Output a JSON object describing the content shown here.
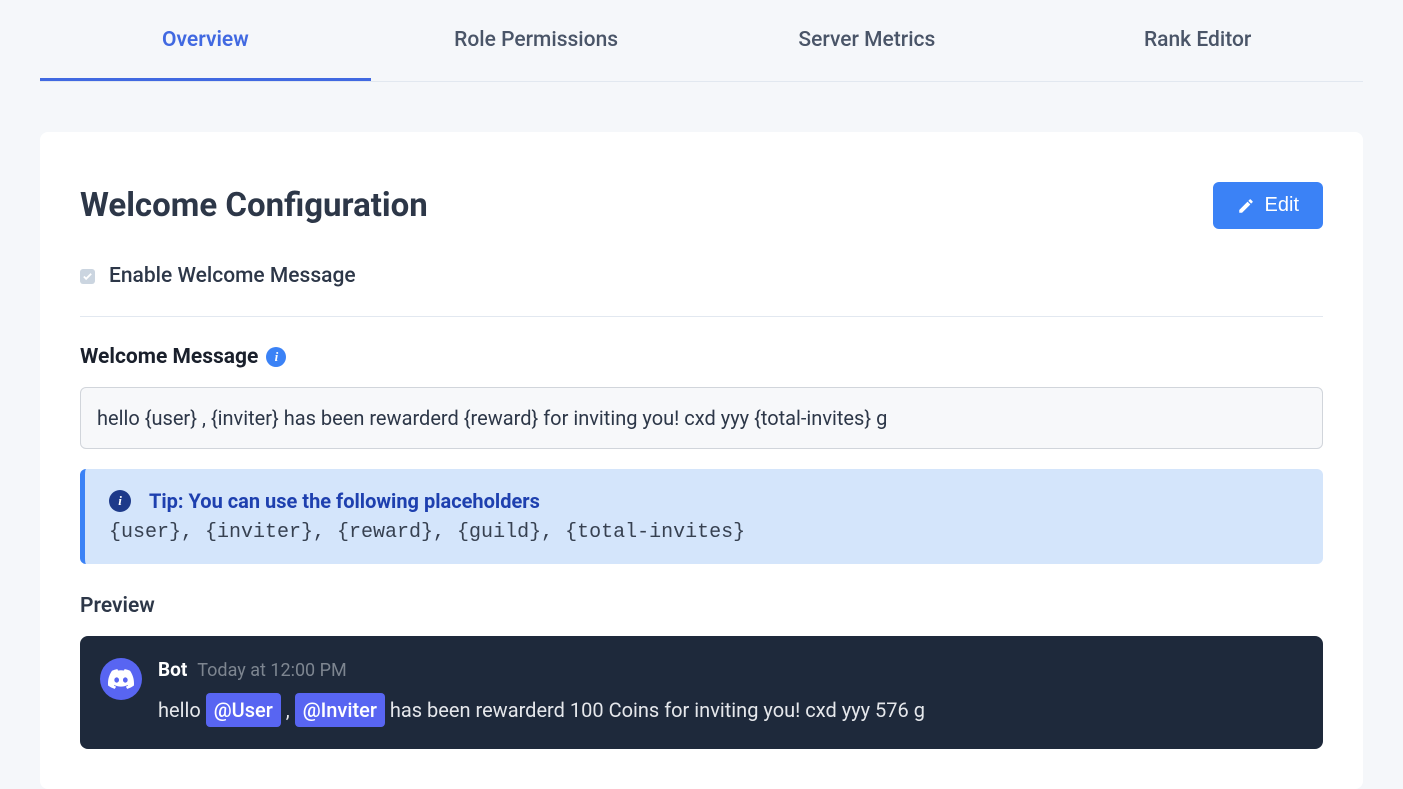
{
  "tabs": [
    {
      "label": "Overview",
      "active": true
    },
    {
      "label": "Role Permissions",
      "active": false
    },
    {
      "label": "Server Metrics",
      "active": false
    },
    {
      "label": "Rank Editor",
      "active": false
    }
  ],
  "card": {
    "title": "Welcome Configuration",
    "edit_label": "Edit",
    "enable_checkbox": {
      "label": "Enable Welcome Message",
      "checked": true
    },
    "welcome_message": {
      "label": "Welcome Message",
      "value": "hello {user} , {inviter} has been rewarderd {reward} for inviting you! cxd yyy {total-invites} g"
    },
    "tip": {
      "title": "Tip: You can use the following placeholders",
      "placeholders": "{user}, {inviter}, {reward}, {guild}, {total-invites}"
    },
    "preview": {
      "label": "Preview",
      "bot_name": "Bot",
      "timestamp": "Today at 12:00 PM",
      "message_parts": {
        "pre_user": "hello ",
        "user_mention": "@User",
        "between": " , ",
        "inviter_mention": "@Inviter",
        "rest": " has been rewarderd 100 Coins for inviting you! cxd yyy 576 g"
      }
    }
  }
}
